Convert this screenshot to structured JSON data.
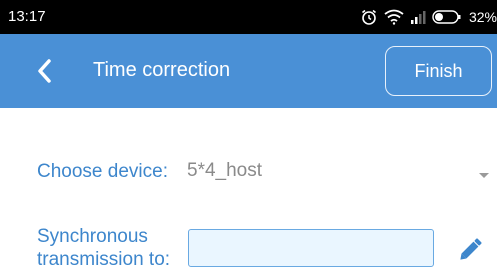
{
  "status_bar": {
    "time": "13:17",
    "icons": [
      "alarm-icon",
      "wifi-icon",
      "signal-icon",
      "battery-icon"
    ],
    "battery": "32%"
  },
  "app_bar": {
    "title": "Time correction",
    "finish_label": "Finish",
    "back_icon": "chevron-left-icon",
    "background": "#4a90d6"
  },
  "form": {
    "device_label": "Choose device:",
    "device_value": "5*4_host",
    "sync_label_line1": "Synchronous",
    "sync_label_line2": "transmission to:",
    "sync_value": "",
    "label_color": "#3d86cc"
  }
}
